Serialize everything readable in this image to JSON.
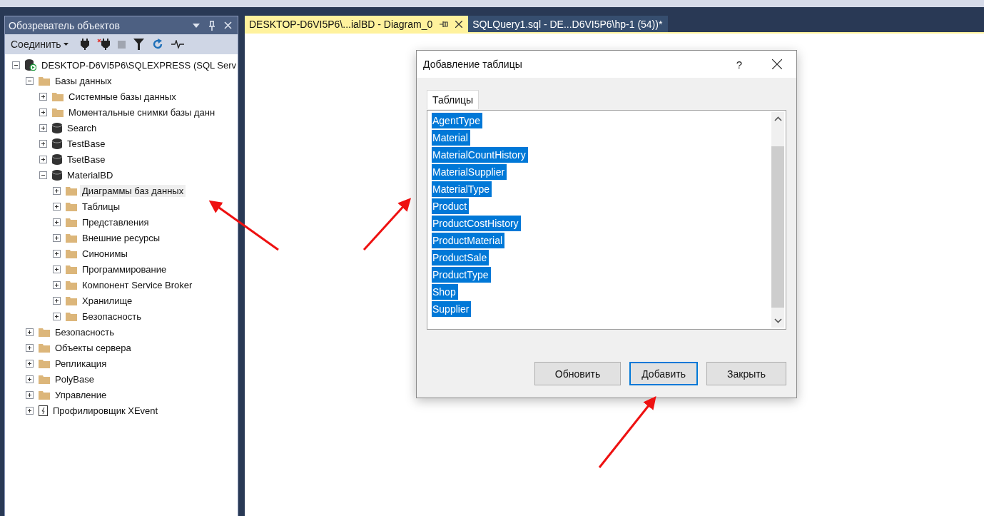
{
  "object_explorer": {
    "title": "Обозреватель объектов",
    "toolbar": {
      "connect_label": "Соединить"
    },
    "tree": [
      {
        "label": "DESKTOP-D6VI5P6\\SQLEXPRESS (SQL Serv",
        "kind": "server",
        "expanded": true,
        "selected": false,
        "children": [
          {
            "label": "Базы данных",
            "kind": "folder",
            "expanded": true,
            "selected": false,
            "children": [
              {
                "label": "Системные базы данных",
                "kind": "folder",
                "expanded": false,
                "selected": false
              },
              {
                "label": "Моментальные снимки базы данн",
                "kind": "folder",
                "expanded": false,
                "selected": false
              },
              {
                "label": "Search",
                "kind": "database",
                "expanded": false,
                "selected": false
              },
              {
                "label": "TestBase",
                "kind": "database",
                "expanded": false,
                "selected": false
              },
              {
                "label": "TsetBase",
                "kind": "database",
                "expanded": false,
                "selected": false
              },
              {
                "label": "MaterialBD",
                "kind": "database",
                "expanded": true,
                "selected": false,
                "children": [
                  {
                    "label": "Диаграммы баз данных",
                    "kind": "folder",
                    "expanded": false,
                    "selected": true
                  },
                  {
                    "label": "Таблицы",
                    "kind": "folder",
                    "expanded": false,
                    "selected": false
                  },
                  {
                    "label": "Представления",
                    "kind": "folder",
                    "expanded": false,
                    "selected": false
                  },
                  {
                    "label": "Внешние ресурсы",
                    "kind": "folder",
                    "expanded": false,
                    "selected": false
                  },
                  {
                    "label": "Синонимы",
                    "kind": "folder",
                    "expanded": false,
                    "selected": false
                  },
                  {
                    "label": "Программирование",
                    "kind": "folder",
                    "expanded": false,
                    "selected": false
                  },
                  {
                    "label": "Компонент Service Broker",
                    "kind": "folder",
                    "expanded": false,
                    "selected": false
                  },
                  {
                    "label": "Хранилище",
                    "kind": "folder",
                    "expanded": false,
                    "selected": false
                  },
                  {
                    "label": "Безопасность",
                    "kind": "folder",
                    "expanded": false,
                    "selected": false
                  }
                ]
              }
            ]
          },
          {
            "label": "Безопасность",
            "kind": "folder",
            "expanded": false,
            "selected": false
          },
          {
            "label": "Объекты сервера",
            "kind": "folder",
            "expanded": false,
            "selected": false
          },
          {
            "label": "Репликация",
            "kind": "folder",
            "expanded": false,
            "selected": false
          },
          {
            "label": "PolyBase",
            "kind": "folder",
            "expanded": false,
            "selected": false
          },
          {
            "label": "Управление",
            "kind": "folder",
            "expanded": false,
            "selected": false
          },
          {
            "label": "Профилировщик XEvent",
            "kind": "xevent",
            "expanded": false,
            "selected": false
          }
        ]
      }
    ]
  },
  "tabs": [
    {
      "label": "DESKTOP-D6VI5P6\\...ialBD - Diagram_0",
      "selected": true
    },
    {
      "label": "SQLQuery1.sql - DE...D6VI5P6\\hp-1 (54))*",
      "selected": false
    }
  ],
  "dialog": {
    "title": "Добавление таблицы",
    "help": "?",
    "tab": "Таблицы",
    "items": [
      {
        "label": "AgentType",
        "selected": true
      },
      {
        "label": "Material",
        "selected": true
      },
      {
        "label": "MaterialCountHistory",
        "selected": true
      },
      {
        "label": "MaterialSupplier",
        "selected": true
      },
      {
        "label": "MaterialType",
        "selected": true
      },
      {
        "label": "Product",
        "selected": true
      },
      {
        "label": "ProductCostHistory",
        "selected": true
      },
      {
        "label": "ProductMaterial",
        "selected": true
      },
      {
        "label": "ProductSale",
        "selected": true
      },
      {
        "label": "ProductType",
        "selected": true
      },
      {
        "label": "Shop",
        "selected": true
      },
      {
        "label": "Supplier",
        "selected": true
      }
    ],
    "buttons": [
      {
        "label": "Обновить",
        "default": false
      },
      {
        "label": "Добавить",
        "default": true
      },
      {
        "label": "Закрыть",
        "default": false
      }
    ]
  }
}
